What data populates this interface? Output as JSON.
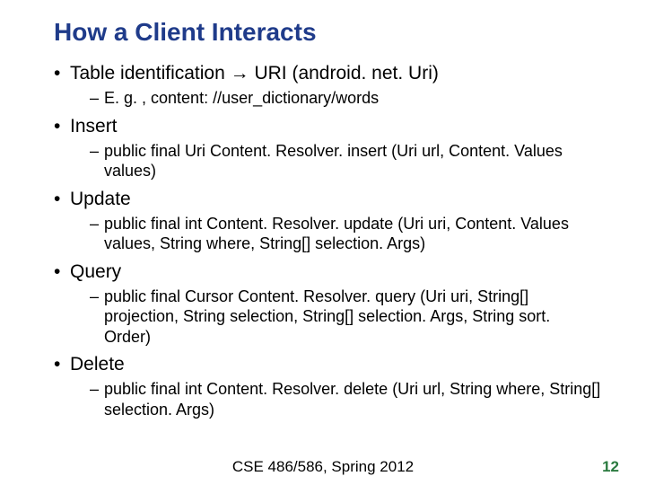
{
  "title": "How a Client Interacts",
  "bullets": {
    "b1": "Table identification ",
    "b1_arrow": "→",
    "b1_after": " URI (android. net. Uri)",
    "b1_sub1": "E. g. , content: //user_dictionary/words",
    "b2": "Insert",
    "b2_sub1": "public final Uri Content. Resolver. insert (Uri url, Content. Values values)",
    "b3": "Update",
    "b3_sub1": "public final int Content. Resolver. update (Uri uri, Content. Values values, String where, String[] selection. Args)",
    "b4": "Query",
    "b4_sub1": "public final Cursor Content. Resolver. query (Uri uri, String[] projection, String selection, String[] selection. Args, String sort. Order)",
    "b5": "Delete",
    "b5_sub1": "public final int Content. Resolver. delete (Uri url, String where, String[] selection. Args)"
  },
  "footer": "CSE 486/586, Spring 2012",
  "page": "12"
}
